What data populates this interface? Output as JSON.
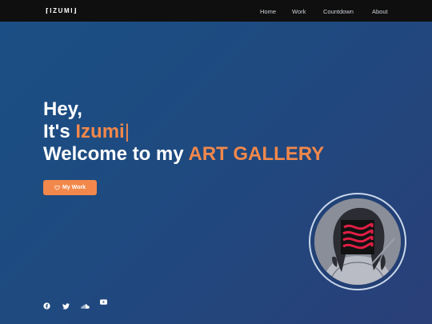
{
  "navbar": {
    "brand": "⌈IZUMI⌋",
    "links": [
      "Home",
      "Work",
      "Countdown",
      "About"
    ]
  },
  "hero": {
    "greeting": "Hey,",
    "intro_prefix": "It's ",
    "name": "Izumi",
    "cursor": "|",
    "welcome_prefix": "Welcome to my ",
    "welcome_highlight": "ART GALLERY"
  },
  "cta": {
    "label": "My Work",
    "icon": "heart-icon"
  },
  "social": [
    "facebook-icon",
    "twitter-icon",
    "soundcloud-icon",
    "youtube-icon"
  ],
  "colors": {
    "accent": "#f2884b",
    "navbar_bg": "#0f0f0f",
    "background": "#1e4a80",
    "avatar_ring": "#c9d7ea"
  }
}
